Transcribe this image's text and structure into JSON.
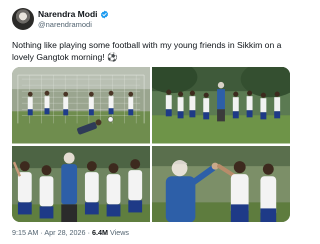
{
  "author": {
    "name": "Narendra Modi",
    "handle": "@narendramodi",
    "verified": true,
    "avatar_icon": "profile-photo"
  },
  "tweet": {
    "text": "Nothing like playing some football with my young friends in Sikkim on a lovely Gangtok morning! ⚽"
  },
  "media": [
    {
      "name": "photo-goal-save",
      "kind": "football-field-goalkeeper"
    },
    {
      "name": "photo-team-lineup",
      "kind": "children-football-practice"
    },
    {
      "name": "photo-kids-celebrating",
      "kind": "children-cheering"
    },
    {
      "name": "photo-high-five",
      "kind": "high-five-with-player"
    }
  ],
  "meta": {
    "time": "9:15 AM",
    "separator": "·",
    "date": "Apr 28, 2026",
    "views_count": "6.4M",
    "views_label": "Views"
  },
  "colors": {
    "verified_blue": "#1d9bf0",
    "text_primary": "#0f1419",
    "text_secondary": "#536471"
  }
}
